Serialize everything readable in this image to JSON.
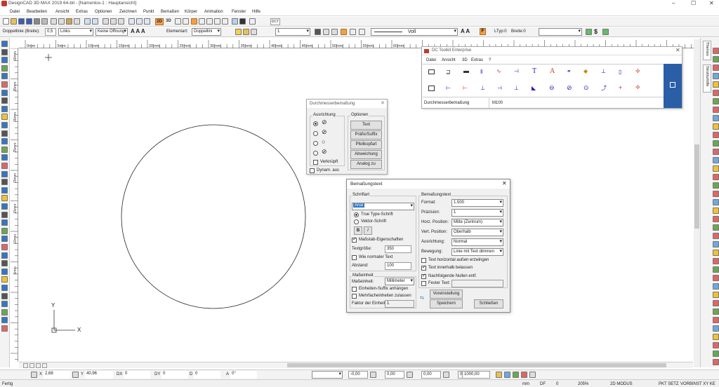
{
  "window": {
    "title": "DesignCAD 3D MAX 2019 64-bit - [Namenlos-1 : Hauptansicht]",
    "min": "–",
    "max": "☐",
    "close": "✕"
  },
  "menu": {
    "items": [
      "Datei",
      "Bearbeiten",
      "Ansicht",
      "Extras",
      "Optionen",
      "Zeichnen",
      "Punkt",
      "Bemaßen",
      "Körper",
      "Animation",
      "Fenster",
      "Hilfe"
    ],
    "badge_2d": "2D",
    "badge_3d": "3D",
    "dct": "DCT"
  },
  "toolbar2": {
    "line_label": "Doppellinie (Breite):",
    "line_width": "0,5",
    "links": "Links",
    "opening": "Keine Öffnung",
    "element_label": "Elementart:",
    "element_value": "Doppellini",
    "layer": "1",
    "linestyle": "Voll",
    "ltyp_label": "LTyp:0",
    "breite_label": "Breite:0"
  },
  "ruler": {
    "labels": [
      "0mm",
      "5mm",
      "10mm",
      "15mm",
      "20mm",
      "25mm",
      "30mm",
      "35mm",
      "40mm",
      "45mm",
      "50mm",
      "55mm",
      "60mm"
    ],
    "vlabels": [
      "40mm",
      "35mm",
      "30mm",
      "25mm",
      "20mm",
      "15mm",
      "10mm",
      "5mm"
    ]
  },
  "axes": {
    "y": "Y",
    "x": "X"
  },
  "right_tabs": [
    "Themes",
    "Strukturhilfe"
  ],
  "dct": {
    "title": "DC Toolkit Enterprise",
    "menu": [
      "Datei",
      "Ansicht",
      "3D",
      "Extras",
      "?"
    ],
    "status_left": "Durchmesserbemaßung",
    "status_mid": "M100"
  },
  "dia": {
    "title": "Durchmesserbemaßung",
    "group_align": "Ausrichtung",
    "group_opt": "Optionen",
    "buttons": [
      "Text",
      "Präfix/Suffix",
      "Pfeilkopfart",
      "Abweichung",
      "Analog zu"
    ],
    "verknupft": "Verknüpft",
    "dynam": "Dynam. aus"
  },
  "bt": {
    "title": "Bemaßungstext",
    "close": "✕",
    "font_group": "Schriftart",
    "font_value": "Arial",
    "truetype": "True Type-Schrift",
    "vector": "Vektor-Schrift",
    "bold": "B",
    "italic": "I",
    "scale_props": "Maßstab-Eigenschaften",
    "text_size_label": "Textgröße:",
    "text_size": "350",
    "like_normal": "Wie normaler Text",
    "distance_label": "Abstand:",
    "distance": "100",
    "unit_group": "Maßeinheit",
    "unit_label": "Maßeinheit:",
    "unit_value": "Millimeter",
    "units_suffix": "Einheiten-Suffix anhängen",
    "multi_units": "Mehrfacheinheiten zulassen",
    "factor_label": "Faktor der Einheit:",
    "factor": "1",
    "text_group": "Bemaßungstext",
    "rows": [
      {
        "label": "Format:",
        "value": "1.500"
      },
      {
        "label": "Präzision:",
        "value": "1"
      },
      {
        "label": "Horz. Position:",
        "value": "Mitte (Zentrum)"
      },
      {
        "label": "Vert. Position:",
        "value": "Oberhalb"
      },
      {
        "label": "Ausrichtung:",
        "value": "Normal"
      },
      {
        "label": "Bewegung:",
        "value": "Linie mit Text dimmen"
      }
    ],
    "cb_outside": "Text horizontal außen erzwingen",
    "cb_within": "Text innerhalb belassen",
    "cb_zeros": "Nachfolgende Nullen entf.",
    "cb_fixed": "Fester Text:",
    "preset": "Voreinstellung",
    "save": "Speichern",
    "close_btn": "Schließen"
  },
  "coords": {
    "x_label": "X",
    "x": "2,68",
    "y_label": "Y",
    "y": "40,96",
    "dx_label": "DX",
    "dx": "0",
    "dy_label": "DY",
    "dy": "0",
    "d_label": "D",
    "d": "0",
    "a_label": "A",
    "a": "0°",
    "v1": "-0,00",
    "v2": "0,00",
    "v3": "0,00",
    "v4": "0,00",
    "v5": "1000,00"
  },
  "status": {
    "left": "Fertig",
    "unit": "mm",
    "df": "DF",
    "zero": "0",
    "zoom": "205%",
    "mode": "2D MODUS",
    "pkt": "PKT SETZ",
    "vorb": "VORBINST XY KE"
  }
}
